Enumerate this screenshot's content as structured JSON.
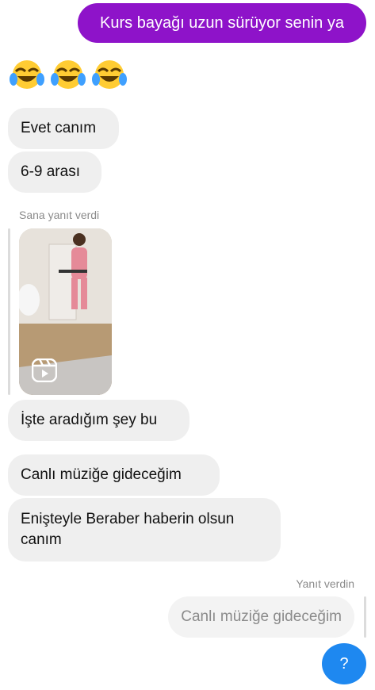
{
  "messages": {
    "outgoing_1": "Kurs bayağı uzun sürüyor senin ya",
    "emoji_reaction": "😂😂😂",
    "incoming_1": "Evet canım",
    "incoming_2": "6-9 arası",
    "reply_caption_incoming": "Sana yanıt verdi",
    "incoming_3": "İşte aradığım şey bu",
    "incoming_4": "Canlı müziğe gideceğim",
    "incoming_5_line1": "Enişteyle Beraber haberin olsun",
    "incoming_5_line2": "canım",
    "reply_caption_outgoing": "Yanıt verdin",
    "replied_quote": "Canlı müziğe gideceğim"
  },
  "fab": {
    "label": "?"
  },
  "colors": {
    "outgoing_bubble": "#8e13c9",
    "incoming_bubble": "#efefef",
    "fab": "#1e88f0"
  },
  "icons": {
    "reel": "reels-icon",
    "emoji": "tears-of-joy-emoji"
  }
}
